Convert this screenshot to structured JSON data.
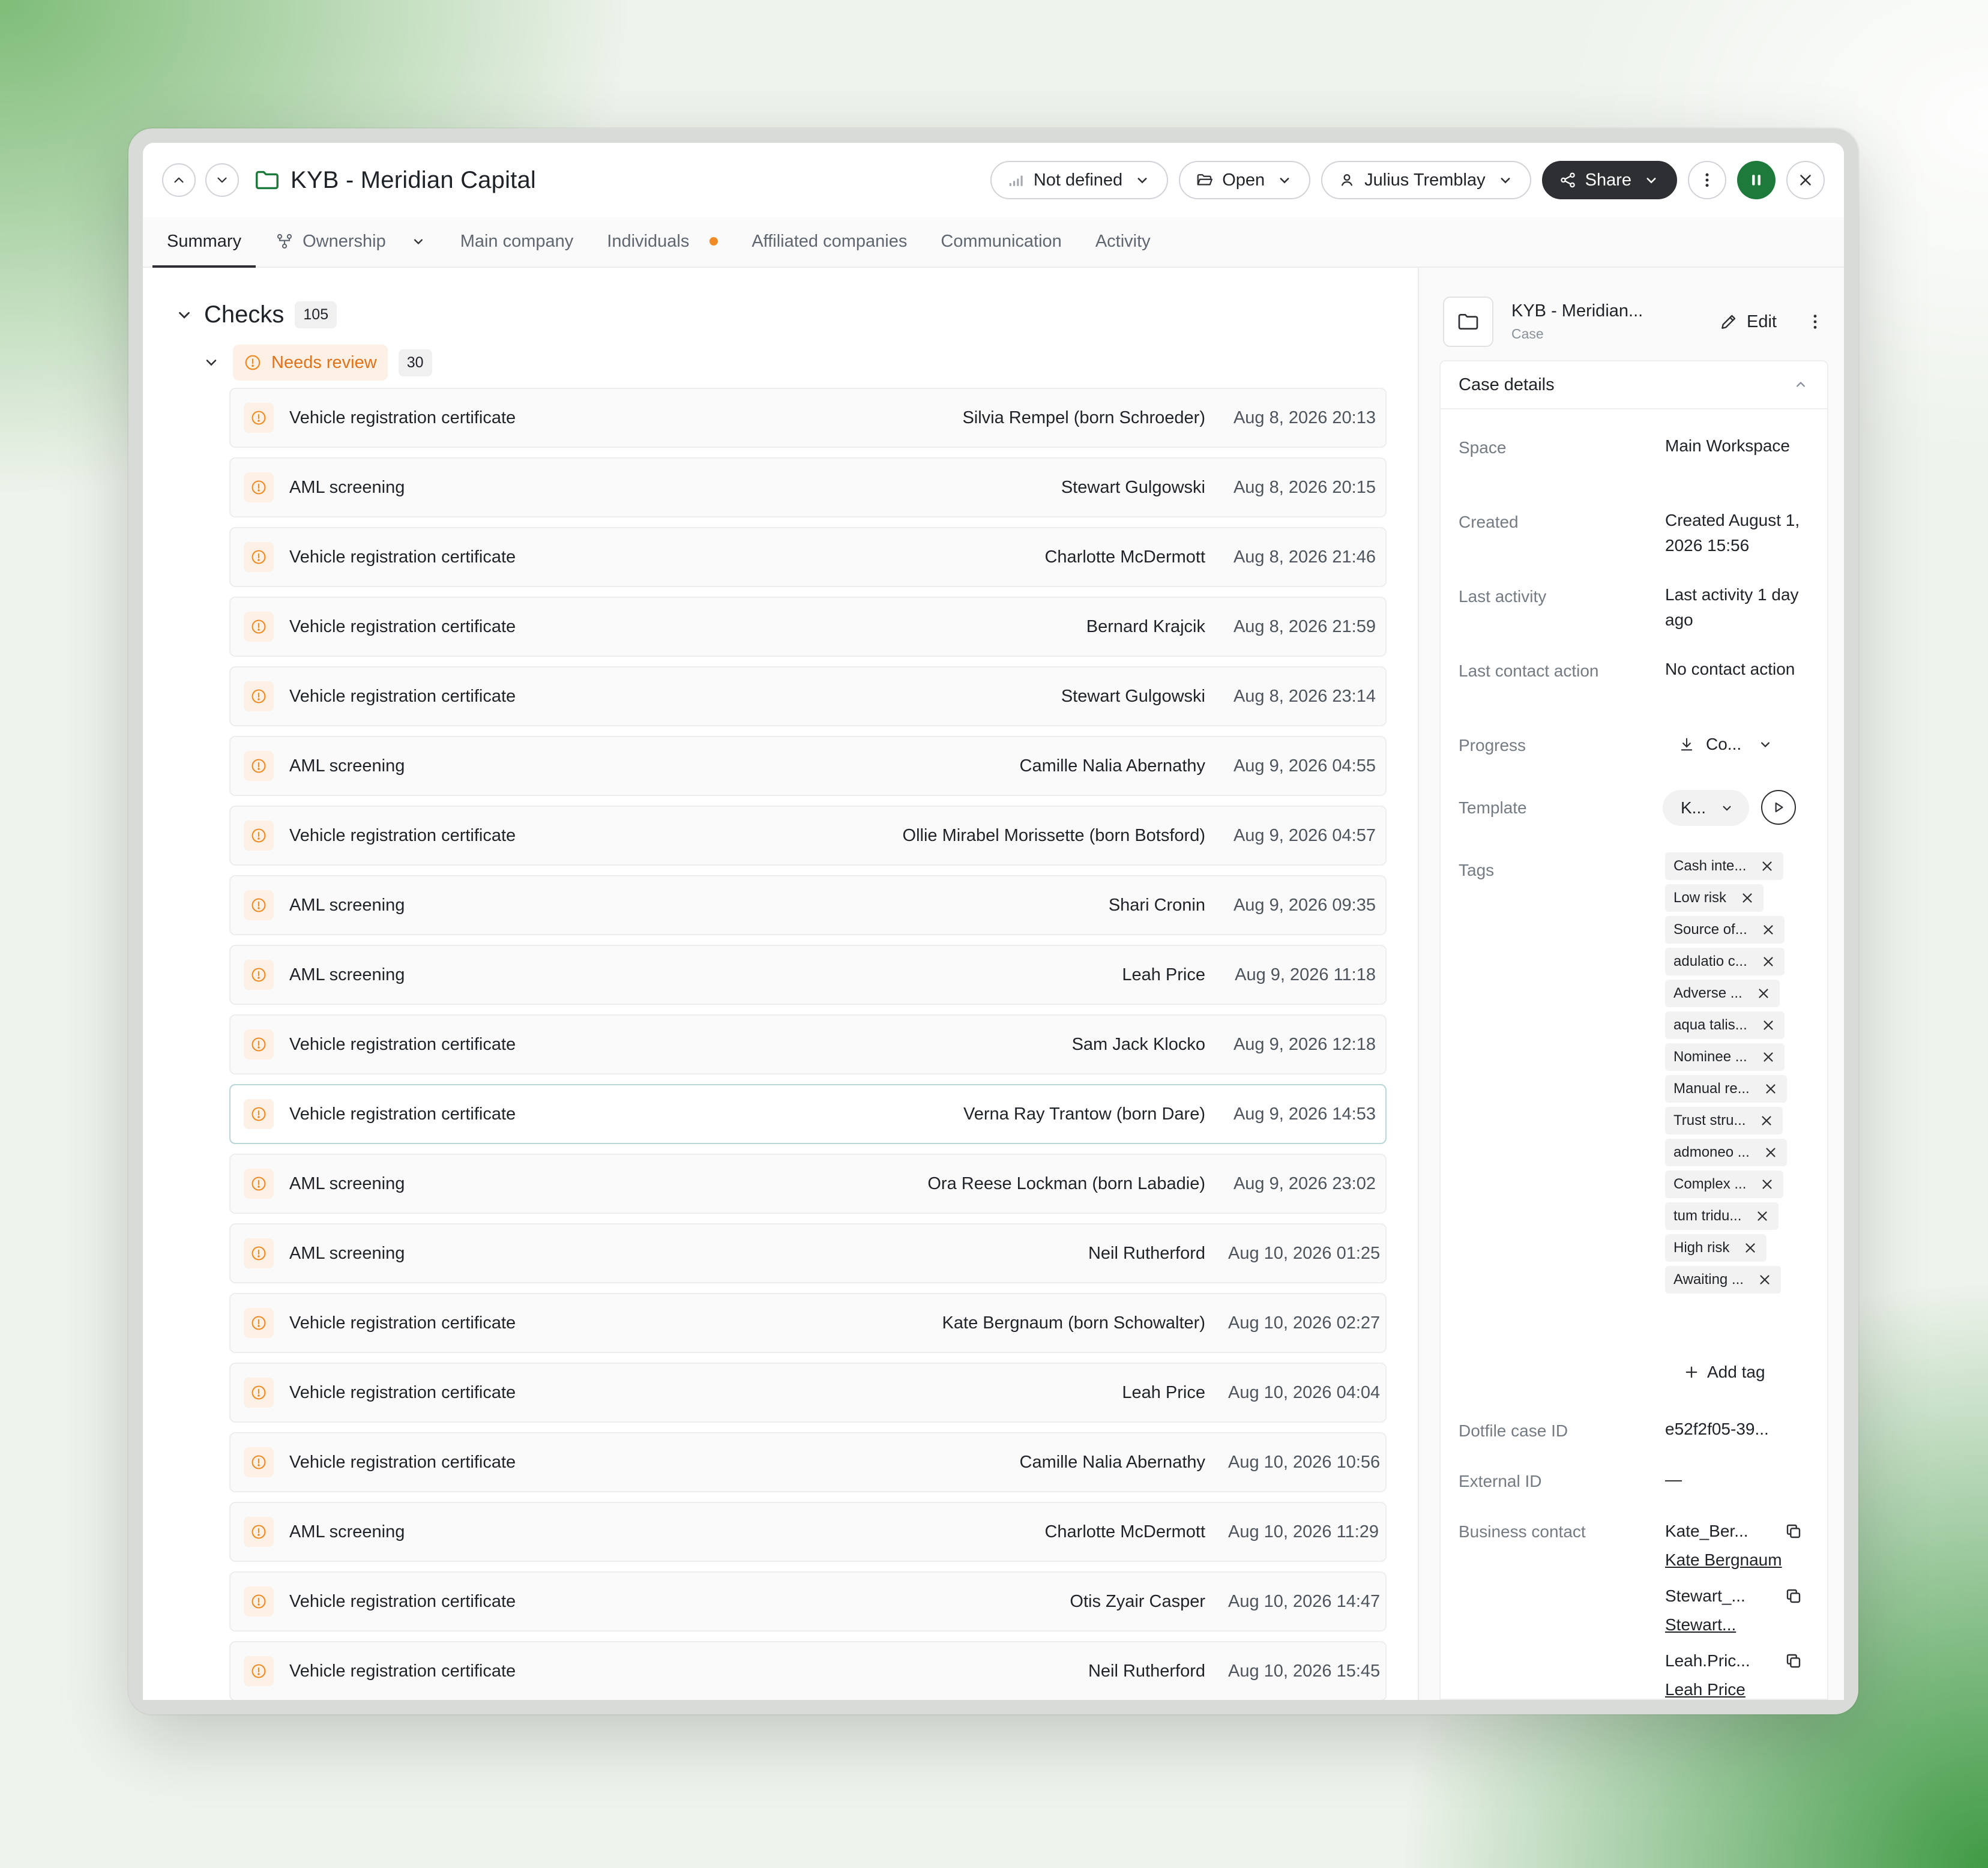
{
  "header": {
    "title": "KYB - Meridian Capital",
    "risk_label": "Not defined",
    "status_label": "Open",
    "assignee": "Julius Tremblay",
    "share_label": "Share"
  },
  "tabs": [
    {
      "label": "Summary"
    },
    {
      "label": "Ownership"
    },
    {
      "label": "Main company"
    },
    {
      "label": "Individuals"
    },
    {
      "label": "Affiliated companies"
    },
    {
      "label": "Communication"
    },
    {
      "label": "Activity"
    }
  ],
  "checks": {
    "title": "Checks",
    "count": "105",
    "group": {
      "label": "Needs review",
      "count": "30"
    },
    "rows": [
      {
        "name": "Vehicle registration certificate",
        "person": "Silvia Rempel (born Schroeder)",
        "date": "Aug 8, 2026 20:13"
      },
      {
        "name": "AML screening",
        "person": "Stewart Gulgowski",
        "date": "Aug 8, 2026 20:15"
      },
      {
        "name": "Vehicle registration certificate",
        "person": "Charlotte McDermott",
        "date": "Aug 8, 2026 21:46"
      },
      {
        "name": "Vehicle registration certificate",
        "person": "Bernard Krajcik",
        "date": "Aug 8, 2026 21:59"
      },
      {
        "name": "Vehicle registration certificate",
        "person": "Stewart Gulgowski",
        "date": "Aug 8, 2026 23:14"
      },
      {
        "name": "AML screening",
        "person": "Camille Nalia Abernathy",
        "date": "Aug 9, 2026 04:55"
      },
      {
        "name": "Vehicle registration certificate",
        "person": "Ollie Mirabel Morissette (born Botsford)",
        "date": "Aug 9, 2026 04:57"
      },
      {
        "name": "AML screening",
        "person": "Shari Cronin",
        "date": "Aug 9, 2026 09:35"
      },
      {
        "name": "AML screening",
        "person": "Leah Price",
        "date": "Aug 9, 2026 11:18"
      },
      {
        "name": "Vehicle registration certificate",
        "person": "Sam Jack Klocko",
        "date": "Aug 9, 2026 12:18"
      },
      {
        "name": "Vehicle registration certificate",
        "person": "Verna Ray Trantow (born Dare)",
        "date": "Aug 9, 2026 14:53"
      },
      {
        "name": "AML screening",
        "person": "Ora Reese Lockman (born Labadie)",
        "date": "Aug 9, 2026 23:02"
      },
      {
        "name": "AML screening",
        "person": "Neil Rutherford",
        "date": "Aug 10, 2026 01:25"
      },
      {
        "name": "Vehicle registration certificate",
        "person": "Kate Bergnaum (born Schowalter)",
        "date": "Aug 10, 2026 02:27"
      },
      {
        "name": "Vehicle registration certificate",
        "person": "Leah Price",
        "date": "Aug 10, 2026 04:04"
      },
      {
        "name": "Vehicle registration certificate",
        "person": "Camille Nalia Abernathy",
        "date": "Aug 10, 2026 10:56"
      },
      {
        "name": "AML screening",
        "person": "Charlotte McDermott",
        "date": "Aug 10, 2026 11:29"
      },
      {
        "name": "Vehicle registration certificate",
        "person": "Otis Zyair Casper",
        "date": "Aug 10, 2026 14:47"
      },
      {
        "name": "Vehicle registration certificate",
        "person": "Neil Rutherford",
        "date": "Aug 10, 2026 15:45"
      }
    ]
  },
  "side": {
    "case_title": "KYB - Meridian...",
    "case_sub": "Case",
    "edit_label": "Edit",
    "details_title": "Case details",
    "space_label": "Space",
    "space_value": "Main Workspace",
    "created_label": "Created",
    "created_value": "Created August 1, 2026 15:56",
    "last_activity_label": "Last activity",
    "last_activity_value": "Last activity 1 day ago",
    "last_contact_label": "Last contact action",
    "last_contact_value": "No contact action",
    "progress_label": "Progress",
    "progress_value": "Co...",
    "template_label": "Template",
    "template_value": "K...",
    "tags_label": "Tags",
    "tags": [
      "Cash inte...",
      "Low risk",
      "Source of...",
      "adulatio c...",
      "Adverse ...",
      "aqua talis...",
      "Nominee ...",
      "Manual re...",
      "Trust stru...",
      "admoneo ...",
      "Complex ...",
      "tum tridu...",
      "High risk",
      "Awaiting ..."
    ],
    "add_tag_label": "Add tag",
    "dotfile_label": "Dotfile case ID",
    "dotfile_value": "e52f2f05-39...",
    "external_label": "External ID",
    "external_value": "—",
    "contact_label": "Business contact",
    "contacts": [
      {
        "handle": "Kate_Ber...",
        "name": "Kate Bergnaum"
      },
      {
        "handle": "Stewart_...",
        "name": "Stewart..."
      },
      {
        "handle": "Leah.Pric...",
        "name": "Leah Price"
      }
    ]
  }
}
